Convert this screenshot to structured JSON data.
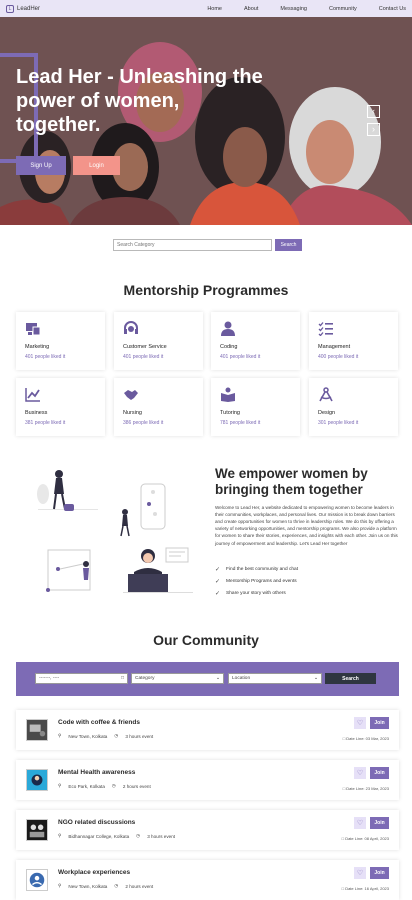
{
  "nav": {
    "brand": "LeadHer",
    "links": [
      "Home",
      "About",
      "Messaging",
      "Community",
      "Contact Us"
    ]
  },
  "hero": {
    "title_line1": "Lead Her - Unleashing the",
    "title_line2": "power of women,",
    "title_line3": "together.",
    "signup": "Sign Up",
    "login": "Login",
    "prev_icon": "chevron-left-icon",
    "next_icon": "chevron-right-icon"
  },
  "search": {
    "placeholder": "Search Category",
    "button": "Search"
  },
  "mentorship": {
    "title": "Mentorship Programmes",
    "cards": [
      {
        "name": "Marketing",
        "likes": "401 people liked it",
        "icon": "marketing-icon"
      },
      {
        "name": "Customer Service",
        "likes": "401 people liked it",
        "icon": "headset-icon"
      },
      {
        "name": "Coding",
        "likes": "401 people liked it",
        "icon": "user-icon"
      },
      {
        "name": "Management",
        "likes": "400 people liked it",
        "icon": "checklist-icon"
      },
      {
        "name": "Business",
        "likes": "381 people liked it",
        "icon": "chart-icon"
      },
      {
        "name": "Nursing",
        "likes": "386 people liked it",
        "icon": "handshake-icon"
      },
      {
        "name": "Tutoring",
        "likes": "781 people liked it",
        "icon": "book-icon"
      },
      {
        "name": "Design",
        "likes": "301 people liked it",
        "icon": "design-icon"
      }
    ]
  },
  "empower": {
    "title_line1": "We empower women by",
    "title_line2": "bringing them together",
    "text": "Welcome to Lead Her, a website dedicated to empowering women to become leaders in their communities, workplaces, and personal lives. Our mission is to break down barriers and create opportunities for women to thrive in leadership roles. We do this by offering a variety of networking opportunities, and mentorship programs. We also provide a platform for women to share their stories, experiences, and insights with each other. Join us on this journey of empowerment and leadership. Let's Lead Her together",
    "points": [
      "Find the best community and chat",
      "Mentorship Programs and events",
      "Share your story with others"
    ]
  },
  "community": {
    "title": "Our Community",
    "date_value": "-------, ----",
    "category": "Category",
    "location": "Location",
    "search": "Search"
  },
  "events": [
    {
      "title": "Code with coffee & friends",
      "location": "New Town, Kolkata",
      "time": "3 hours event",
      "date": "Date Line: 03 Mar, 2023",
      "join": "Join"
    },
    {
      "title": "Mental Health awareness",
      "location": "Eco Park, Kolkata",
      "time": "2 hours event",
      "date": "Date Line: 23 Mar, 2023",
      "join": "Join"
    },
    {
      "title": "NGO related discussions",
      "location": "Bidhannagar College, Kolkata",
      "time": "3 hours event",
      "date": "Date Line: 08 April, 2023",
      "join": "Join"
    },
    {
      "title": "Workplace experiences",
      "location": "New Town, Kolkata",
      "time": "2 hours event",
      "date": "Date Line: 16 April, 2023",
      "join": "Join"
    }
  ],
  "colors": {
    "accent": "#7d6bb5",
    "coral": "#f3948a",
    "dark": "#2f3640",
    "hero_bg": "#6f5252"
  }
}
